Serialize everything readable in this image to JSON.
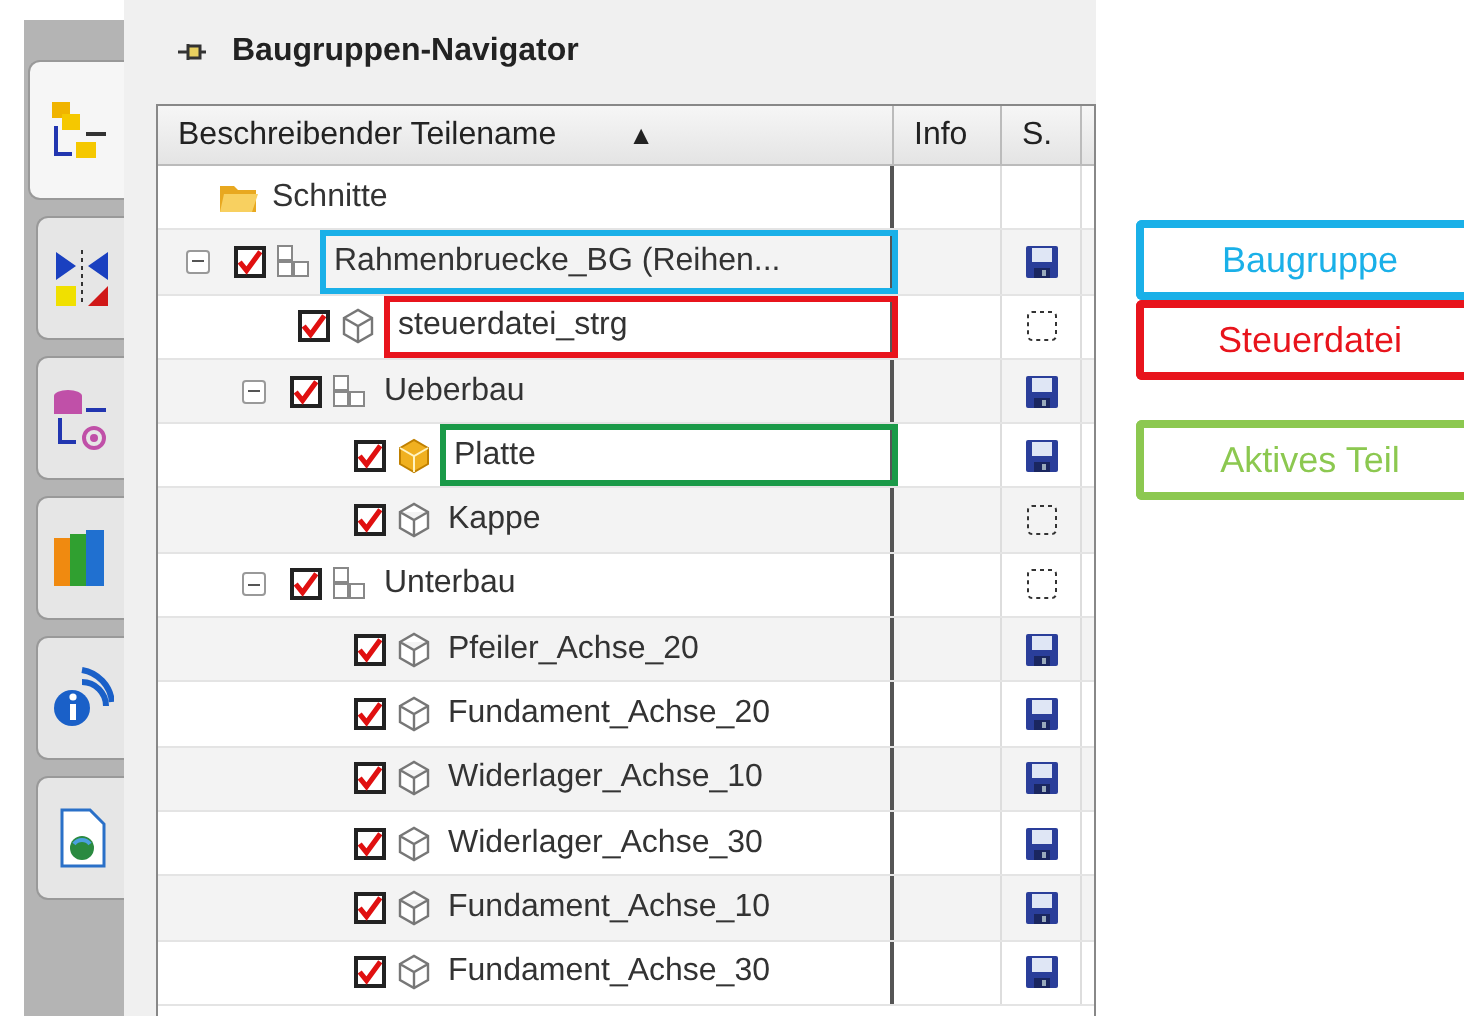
{
  "side_tabs": [
    {
      "kind": "hierarchy",
      "selected": true
    },
    {
      "kind": "mirror",
      "selected": false
    },
    {
      "kind": "database",
      "selected": false
    },
    {
      "kind": "books",
      "selected": false
    },
    {
      "kind": "info",
      "selected": false
    },
    {
      "kind": "document",
      "selected": false
    }
  ],
  "navigator": {
    "title": "Baugruppen-Navigator",
    "columns": [
      {
        "label": "Beschreibender Teilename",
        "sort": "▲"
      },
      {
        "label": "Info"
      },
      {
        "label": "S."
      }
    ],
    "tree": [
      {
        "kind": "folder",
        "name": "Schnitte"
      },
      {
        "kind": "assembly",
        "name": "Rahmenbruecke_BG (Reihen...",
        "checked": true,
        "expanded": true,
        "saved": true,
        "color": "#1ab0e8",
        "children": [
          {
            "kind": "part",
            "name": "steuerdatei_strg",
            "checked": true,
            "saved": false,
            "color": "#e8141c"
          },
          {
            "kind": "assembly",
            "name": "Ueberbau",
            "checked": true,
            "expanded": true,
            "saved": true,
            "children": [
              {
                "kind": "active_part",
                "name": "Platte",
                "checked": true,
                "saved": true,
                "color": "#1a9a48"
              },
              {
                "kind": "part",
                "name": "Kappe",
                "checked": true,
                "saved": false
              }
            ]
          },
          {
            "kind": "assembly",
            "name": "Unterbau",
            "checked": true,
            "expanded": true,
            "saved": false,
            "children": [
              {
                "kind": "part",
                "name": "Pfeiler_Achse_20",
                "checked": true,
                "saved": true
              },
              {
                "kind": "part",
                "name": "Fundament_Achse_20",
                "checked": true,
                "saved": true
              },
              {
                "kind": "part",
                "name": "Widerlager_Achse_10",
                "checked": true,
                "saved": true
              },
              {
                "kind": "part",
                "name": "Widerlager_Achse_30",
                "checked": true,
                "saved": true
              },
              {
                "kind": "part",
                "name": "Fundament_Achse_10",
                "checked": true,
                "saved": true
              },
              {
                "kind": "part",
                "name": "Fundament_Achse_30",
                "checked": true,
                "saved": true
              }
            ]
          }
        ]
      }
    ]
  },
  "legend": [
    {
      "label": "Baugruppe",
      "color": "#1ab0e8"
    },
    {
      "label": "Steuerdatei",
      "color": "#e8141c"
    },
    {
      "label": "Aktives Teil",
      "color": "#8cc850"
    }
  ]
}
